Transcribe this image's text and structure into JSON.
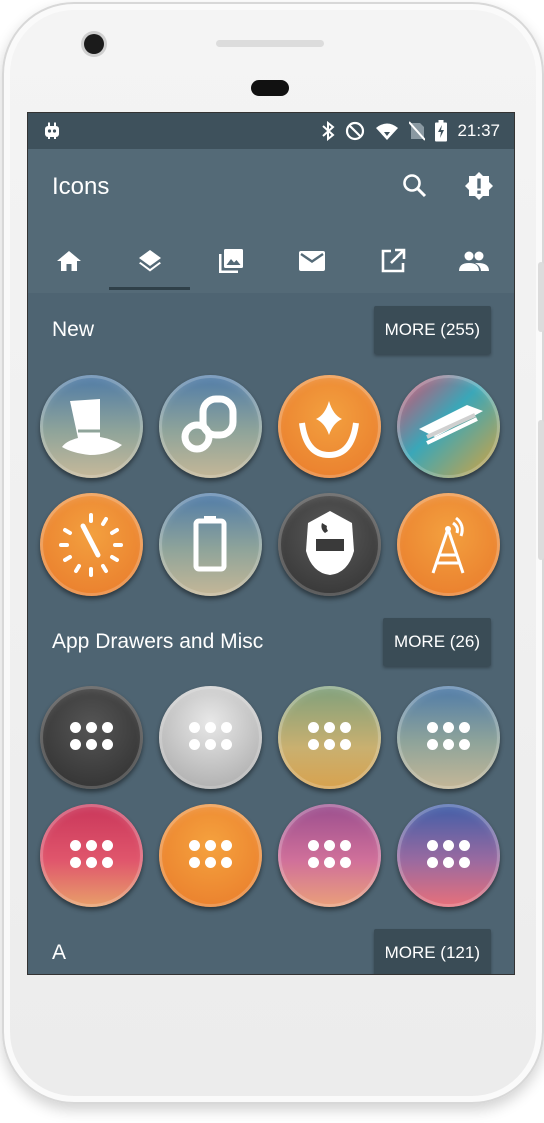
{
  "status_bar": {
    "time": "21:37",
    "icons": [
      "android-debug-icon",
      "bluetooth-icon",
      "do-not-disturb-icon",
      "wifi-icon",
      "no-sim-icon",
      "battery-charging-icon"
    ]
  },
  "app_bar": {
    "title": "Icons",
    "actions": [
      "search-icon",
      "alert-badge-icon"
    ]
  },
  "tabs": [
    {
      "icon": "home-icon",
      "active": false
    },
    {
      "icon": "layers-icon",
      "active": true
    },
    {
      "icon": "photo-library-icon",
      "active": false
    },
    {
      "icon": "mail-icon",
      "active": false
    },
    {
      "icon": "open-in-new-icon",
      "active": false
    },
    {
      "icon": "people-icon",
      "active": false
    }
  ],
  "sections": {
    "new": {
      "title": "New",
      "more_label": "MORE (255)"
    },
    "drawers": {
      "title": "App Drawers and Misc",
      "more_label": "MORE (26)"
    },
    "a": {
      "title": "A",
      "more_label": "MORE (121)"
    }
  },
  "colors": {
    "background": "#4e6472",
    "app_bar": "#546a77",
    "status_bar": "#3e515c",
    "button": "#3a4c56"
  }
}
